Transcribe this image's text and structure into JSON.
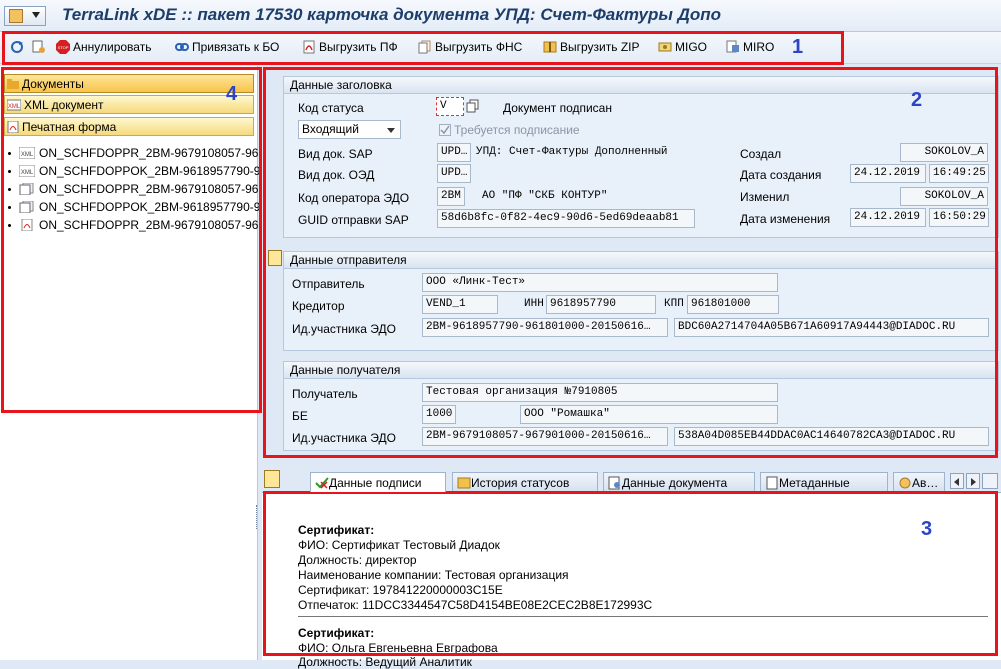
{
  "window": {
    "title": "TerraLink xDE :: пакет 17530 карточка документа УПД: Счет-Фактуры Допо"
  },
  "toolbar": {
    "annul": "Аннулировать",
    "bind_bo": "Привязать к БО",
    "export_pf": "Выгрузить ПФ",
    "export_fns": "Выгрузить ФНС",
    "export_zip": "Выгрузить ZIP",
    "migo": "MIGO",
    "miro": "MIRO"
  },
  "markers": {
    "m1": "1",
    "m2": "2",
    "m3": "3",
    "m4": "4"
  },
  "nav": {
    "documents": "Документы",
    "xml_document": "XML документ",
    "print_form": "Печатная форма",
    "files": [
      "ON_SCHFDOPPR_2BM-9679108057-96",
      "ON_SCHFDOPPOK_2BM-9618957790-9",
      "ON_SCHFDOPPR_2BM-9679108057-96",
      "ON_SCHFDOPPOK_2BM-9618957790-9",
      "ON_SCHFDOPPR_2BM-9679108057-96"
    ]
  },
  "header_section": {
    "title": "Данные заголовка",
    "status_code_label": "Код статуса",
    "status_code_value": "V",
    "status_text": "Документ подписан",
    "direction_value": "Входящий",
    "signing_required": "Требуется подписание",
    "sap_doc_type_label": "Вид док. SAP",
    "sap_doc_type_value": "UPD…",
    "sap_doc_type_text": "УПД: Счет-Фактуры Дополненный",
    "edo_doc_type_label": "Вид док. ОЭД",
    "edo_doc_type_value": "UPD…",
    "edo_operator_label": "Код оператора ЭДО",
    "edo_operator_value": "2BM",
    "edo_operator_text": "АО \"ПФ \"СКБ КОНТУР\"",
    "guid_label": "GUID отправки SAP",
    "guid_value": "58d6b8fc-0f82-4ec9-90d6-5ed69deaab81",
    "created_by_label": "Создал",
    "created_by_value": "SOKOLOV_A",
    "created_date_label": "Дата создания",
    "created_date_value": "24.12.2019",
    "created_time_value": "16:49:25",
    "changed_by_label": "Изменил",
    "changed_by_value": "SOKOLOV_A",
    "changed_date_label": "Дата изменения",
    "changed_date_value": "24.12.2019",
    "changed_time_value": "16:50:29"
  },
  "sender_section": {
    "title": "Данные отправителя",
    "sender_label": "Отправитель",
    "sender_value": "ООО «Линк-Тест»",
    "creditor_label": "Кредитор",
    "creditor_value": "VEND_1",
    "inn_label": "ИНН",
    "inn_value": "9618957790",
    "kpp_label": "КПП",
    "kpp_value": "961801000",
    "edo_id_label": "Ид.участника ЭДО",
    "edo_id_value": "2BM-9618957790-961801000-20150616…",
    "edo_box_value": "BDC60A2714704A05B671A60917A94443@DIADOC.RU"
  },
  "receiver_section": {
    "title": "Данные получателя",
    "receiver_label": "Получатель",
    "receiver_value": "Тестовая организация №7910805",
    "be_label": "БЕ",
    "be_value": "1000",
    "be_name_value": "ООО \"Ромашка\"",
    "edo_id_label": "Ид.участника ЭДО",
    "edo_id_value": "2BM-9679108057-967901000-20150616…",
    "edo_box_value": "538A04D085EB44DDAC0AC14640782CA3@DIADOC.RU"
  },
  "tabs": [
    {
      "label": "Данные подписи"
    },
    {
      "label": "История статусов"
    },
    {
      "label": "Данные документа"
    },
    {
      "label": "Метаданные"
    },
    {
      "label": "Ав…"
    }
  ],
  "certificates": {
    "c1_title": "Сертификат:",
    "c1_fio": "ФИО: Сертификат Тестовый Диадок",
    "c1_position": "Должность: директор",
    "c1_company": "Наименование компании: Тестовая организация",
    "c1_cert": "Сертификат: 197841220000003C15E",
    "c1_thumb": "Отпечаток: 11DCC3344547C58D4154BE08E2CEC2B8E172993C",
    "c2_title": "Сертификат:",
    "c2_fio": "ФИО: Ольга Евгеньевна Евграфова",
    "c2_position": "Должность: Ведущий Аналитик"
  }
}
